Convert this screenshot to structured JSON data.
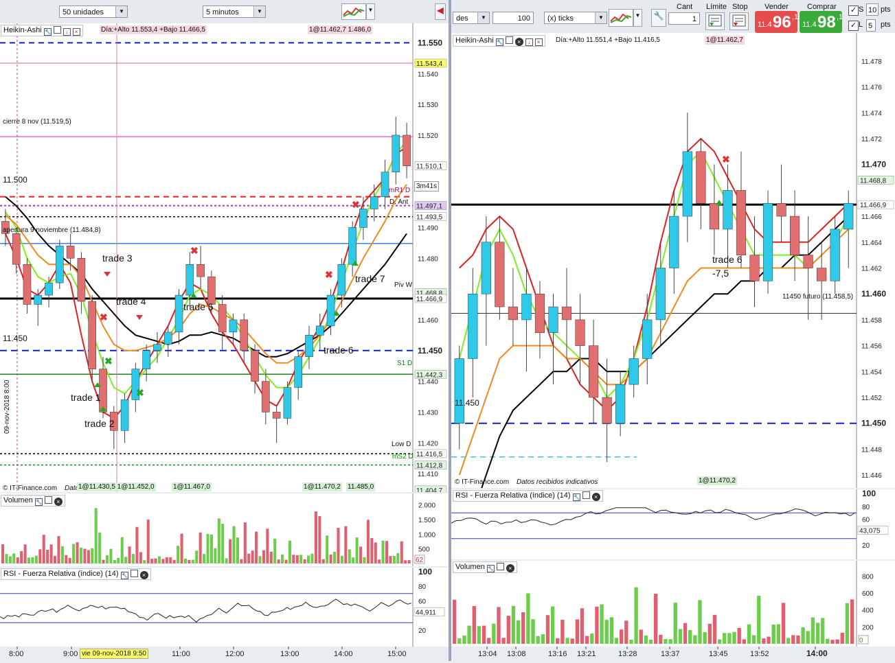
{
  "left_toolbar": {
    "quantity": "50 unidades",
    "timeframe": "5 minutos"
  },
  "right_toolbar": {
    "account_fragment": "des",
    "ticks_value": "100",
    "ticks_unit": "(x) ticks",
    "cant_label": "Cant",
    "cant_value": "1",
    "limite_label": "Límite",
    "stop_label": "Stop",
    "vender_label": "Vender",
    "vender_prefix": "11.4",
    "vender_big": "96",
    "vender_sup": ",1",
    "comprar_label": "Comprar",
    "comprar_prefix": "11.4",
    "comprar_big": "98",
    "comprar_sup": ",1",
    "s_label": "S",
    "s_value": "10",
    "s_unit": "pts",
    "l_label": "L",
    "l_value": "5",
    "l_unit": "pts"
  },
  "left_panel": {
    "title": "Heikin-Ashi",
    "overlay": "Día:+Alto 11.553,4 +Bajo 11.466,5",
    "top_tag": "1@11.462,7  1.486,0",
    "bottom_tags": [
      "1@11.430,5 1@11.452,0",
      "1@11.467,0",
      "1@11.470,2",
      "11.485,0"
    ],
    "timer": "3m41s",
    "lines": [
      "cierre 8 nov (11.519,5)",
      "11.500",
      "apertura 9 noviembre (11.484,8)",
      "11.450",
      "Piv W",
      "S1 D",
      "Low D",
      "mS2 D",
      "D, Ant",
      "mR1 D"
    ],
    "vertical_date": "09-nov-2018 8:00",
    "footer": "© IT-Finance.com",
    "footer2": "Datos recibidos indicativos"
  },
  "right_panel": {
    "title": "Heikin-Ashi",
    "overlay": "Día:+Alto 11.551,4 +Bajo 11.416,5",
    "top_tag": "1@11.462,7",
    "bottom_tag": "1@11.470,2",
    "futuro": "11450 futuro (11.458,5)",
    "line_label": "11.450",
    "footer": "© IT-Finance.com",
    "footer2": "Datos recibidos indicativos"
  },
  "left_volume": {
    "title": "Volumen",
    "axis": [
      "2.000",
      "1.500",
      "1.000",
      "500"
    ],
    "last": "62"
  },
  "left_rsi": {
    "title": "RSI - Fuerza Relativa (índice) (14)",
    "axis": [
      "100",
      "80",
      "60",
      "20"
    ],
    "last": "44,911"
  },
  "right_rsi": {
    "title": "RSI - Fuerza Relativa (índice) (14)",
    "axis": [
      "100",
      "80",
      "60",
      "20"
    ],
    "last": "43,075"
  },
  "right_volume": {
    "title": "Volumen",
    "axis": [
      "800",
      "600",
      "400",
      "200"
    ],
    "last": "0"
  },
  "left_xaxis": [
    "8:00",
    "9:00",
    "11:00",
    "12:00",
    "13:00",
    "14:00",
    "15:00"
  ],
  "left_cursor_date": "vie 09-nov-2018 9:50",
  "right_xaxis": [
    "13:04",
    "13:08",
    "13:16",
    "13:21",
    "13:28",
    "13:37",
    "13:45",
    "13:52",
    "14:00"
  ],
  "left_yaxis": [
    "11.550",
    "11.540",
    "11.530",
    "11.520",
    "11.490",
    "11.480",
    "11.460",
    "11.450",
    "11.440",
    "11.430",
    "11.420",
    "11.410"
  ],
  "left_ytags": [
    {
      "text": "11.543,4",
      "bg": "#ffff66"
    },
    {
      "text": "11.510,1",
      "bg": "#ffffff"
    },
    {
      "text": "11.497,1",
      "bg": "#e0c8f0"
    },
    {
      "text": "11.493,5",
      "bg": "#ffffff"
    },
    {
      "text": "11.468,8",
      "bg": "#e2f5e2"
    },
    {
      "text": "11.466,9",
      "bg": "#ffffff"
    },
    {
      "text": "11.442,3",
      "bg": "#e2f5e2"
    },
    {
      "text": "11.416,5",
      "bg": "#ffffff"
    },
    {
      "text": "11.412,8",
      "bg": "#e2f5e2"
    },
    {
      "text": "11.404,7",
      "bg": "#e2f5e2"
    }
  ],
  "right_yaxis": [
    "11.478",
    "11.476",
    "11.474",
    "11.472",
    "11.470",
    "11.466",
    "11.464",
    "11.462",
    "11.460",
    "11.458",
    "11.456",
    "11.454",
    "11.452",
    "11.450",
    "11.448",
    "11.446"
  ],
  "right_ytags": [
    {
      "text": "11.468,8",
      "bg": "#e2f5e2"
    },
    {
      "text": "11.466,9",
      "bg": "#ffffff"
    }
  ],
  "trades_left": [
    "trade 1",
    "trade 2",
    "trade 3",
    "trade 4",
    "trade 5",
    "trade 6",
    "trade 7"
  ],
  "trades_right": [
    "trade 6",
    "-7,5"
  ],
  "chart_data": [
    {
      "type": "candlestick",
      "name": "Heikin-Ashi 5 minutos",
      "x_range": [
        "08:00",
        "15:10"
      ],
      "ylim": [
        11404,
        11555
      ],
      "ohlc": [
        [
          11492,
          11496,
          11484,
          11488
        ],
        [
          11488,
          11490,
          11475,
          11478
        ],
        [
          11478,
          11480,
          11462,
          11465
        ],
        [
          11465,
          11470,
          11458,
          11468
        ],
        [
          11468,
          11474,
          11464,
          11472
        ],
        [
          11472,
          11486,
          11470,
          11484
        ],
        [
          11484,
          11488,
          11476,
          11480
        ],
        [
          11480,
          11482,
          11462,
          11466
        ],
        [
          11466,
          11468,
          11440,
          11444
        ],
        [
          11444,
          11448,
          11428,
          11430
        ],
        [
          11430,
          11432,
          11418,
          11424
        ],
        [
          11424,
          11436,
          11420,
          11434
        ],
        [
          11434,
          11446,
          11430,
          11444
        ],
        [
          11444,
          11452,
          11440,
          11450
        ],
        [
          11450,
          11456,
          11446,
          11452
        ],
        [
          11452,
          11458,
          11448,
          11456
        ],
        [
          11456,
          11470,
          11452,
          11468
        ],
        [
          11468,
          11482,
          11464,
          11478
        ],
        [
          11478,
          11484,
          11470,
          11474
        ],
        [
          11474,
          11476,
          11462,
          11465
        ],
        [
          11465,
          11468,
          11450,
          11456
        ],
        [
          11456,
          11462,
          11452,
          11460
        ],
        [
          11460,
          11462,
          11446,
          11450
        ],
        [
          11450,
          11452,
          11436,
          11440
        ],
        [
          11440,
          11444,
          11426,
          11430
        ],
        [
          11430,
          11432,
          11420,
          11428
        ],
        [
          11428,
          11440,
          11426,
          11438
        ],
        [
          11438,
          11450,
          11434,
          11448
        ],
        [
          11448,
          11458,
          11444,
          11455
        ],
        [
          11455,
          11462,
          11450,
          11458
        ],
        [
          11458,
          11470,
          11455,
          11468
        ],
        [
          11468,
          11480,
          11464,
          11478
        ],
        [
          11478,
          11492,
          11474,
          11490
        ],
        [
          11490,
          11500,
          11486,
          11496
        ],
        [
          11496,
          11504,
          11492,
          11500
        ],
        [
          11500,
          11512,
          11496,
          11508
        ],
        [
          11508,
          11526,
          11504,
          11520
        ],
        [
          11520,
          11524,
          11506,
          11510
        ]
      ],
      "series": [
        {
          "name": "MA",
          "color": "#000000",
          "values": [
            11500,
            11497,
            11493,
            11488,
            11484,
            11481,
            11478,
            11475,
            11470,
            11466,
            11462,
            11458,
            11455,
            11454,
            11453,
            11452,
            11453,
            11455,
            11455,
            11456,
            11455,
            11454,
            11452,
            11450,
            11448,
            11448,
            11449,
            11451,
            11453,
            11455,
            11458,
            11462,
            11466,
            11470,
            11474,
            11478,
            11483,
            11488
          ]
        },
        {
          "name": "MA",
          "color": "#e02020",
          "values": [
            11488,
            11480,
            11470,
            11468,
            11472,
            11478,
            11472,
            11455,
            11440,
            11430,
            11428,
            11432,
            11440,
            11446,
            11452,
            11458,
            11466,
            11472,
            11470,
            11462,
            11456,
            11452,
            11446,
            11440,
            11434,
            11432,
            11438,
            11446,
            11452,
            11458,
            11466,
            11476,
            11488,
            11498,
            11502,
            11506,
            11514,
            11516
          ]
        },
        {
          "name": "MA",
          "color": "#7cf020",
          "values": [
            11495,
            11490,
            11480,
            11474,
            11472,
            11474,
            11475,
            11468,
            11456,
            11446,
            11438,
            11436,
            11440,
            11444,
            11448,
            11454,
            11460,
            11468,
            11470,
            11468,
            11464,
            11460,
            11454,
            11448,
            11442,
            11438,
            11438,
            11442,
            11448,
            11454,
            11462,
            11472,
            11482,
            11492,
            11500,
            11506,
            11514,
            11518
          ]
        },
        {
          "name": "MA",
          "color": "#f08a20",
          "values": [
            11494,
            11491,
            11486,
            11481,
            11478,
            11478,
            11478,
            11474,
            11466,
            11458,
            11452,
            11450,
            11450,
            11451,
            11452,
            11454,
            11457,
            11462,
            11465,
            11464,
            11462,
            11460,
            11457,
            11453,
            11449,
            11446,
            11446,
            11448,
            11451,
            11455,
            11460,
            11466,
            11473,
            11480,
            11486,
            11492,
            11499,
            11504
          ]
        }
      ],
      "annotations": [
        "trade 1",
        "trade 2",
        "trade 3",
        "trade 4",
        "trade 5",
        "trade 6",
        "trade 7",
        "cierre 8 nov (11.519,5)",
        "apertura 9 noviembre (11.484,8)"
      ],
      "levels": [
        11519.5,
        11500,
        11493.5,
        11484.8,
        11466.9,
        11450,
        11442.3,
        11416.5,
        11412.8
      ]
    },
    {
      "type": "candlestick",
      "name": "Heikin-Ashi",
      "x_range": [
        "13:00",
        "14:03"
      ],
      "ylim": [
        11445,
        11479
      ],
      "ohlc": [
        [
          11450,
          11456,
          11448,
          11455
        ],
        [
          11455,
          11462,
          11452,
          11460
        ],
        [
          11460,
          11466,
          11456,
          11464
        ],
        [
          11464,
          11466,
          11458,
          11459
        ],
        [
          11459,
          11462,
          11456,
          11458
        ],
        [
          11458,
          11462,
          11454,
          11460
        ],
        [
          11460,
          11461,
          11455,
          11457
        ],
        [
          11457,
          11460,
          11453,
          11459
        ],
        [
          11459,
          11462,
          11455,
          11458
        ],
        [
          11458,
          11460,
          11453,
          11456
        ],
        [
          11456,
          11458,
          11450,
          11452
        ],
        [
          11452,
          11455,
          11447,
          11450
        ],
        [
          11450,
          11454,
          11449,
          11453
        ],
        [
          11453,
          11456,
          11452,
          11455
        ],
        [
          11455,
          11460,
          11453,
          11458
        ],
        [
          11458,
          11464,
          11456,
          11462
        ],
        [
          11462,
          11468,
          11460,
          11466
        ],
        [
          11466,
          11474,
          11464,
          11471
        ],
        [
          11471,
          11472,
          11465,
          11467
        ],
        [
          11467,
          11470,
          11463,
          11465
        ],
        [
          11465,
          11470,
          11462,
          11468
        ],
        [
          11468,
          11471,
          11462,
          11463
        ],
        [
          11463,
          11466,
          11459,
          11461
        ],
        [
          11461,
          11468,
          11460,
          11467
        ],
        [
          11467,
          11470,
          11464,
          11466
        ],
        [
          11466,
          11468,
          11461,
          11463
        ],
        [
          11463,
          11466,
          11458,
          11462
        ],
        [
          11462,
          11464,
          11458,
          11461
        ],
        [
          11461,
          11466,
          11460,
          11465
        ],
        [
          11465,
          11468,
          11462,
          11467
        ]
      ],
      "series": [
        {
          "name": "MA",
          "color": "#000000",
          "values": [
            11440,
            11443,
            11446,
            11449,
            11451,
            11452,
            11453,
            11454,
            11454,
            11455,
            11455,
            11454,
            11454,
            11454,
            11455,
            11456,
            11457,
            11458,
            11459,
            11460,
            11460,
            11461,
            11461,
            11462,
            11462,
            11463,
            11463,
            11464,
            11465,
            11466
          ]
        },
        {
          "name": "MA",
          "color": "#e02020",
          "values": [
            11462,
            11463,
            11465,
            11466,
            11465,
            11462,
            11459,
            11456,
            11455,
            11453,
            11452,
            11451,
            11452,
            11455,
            11459,
            11464,
            11468,
            11471,
            11472,
            11471,
            11469,
            11467,
            11465,
            11464,
            11464,
            11464,
            11464,
            11465,
            11466,
            11467
          ]
        },
        {
          "name": "MA",
          "color": "#7cf020",
          "values": [
            11455,
            11459,
            11463,
            11465,
            11463,
            11460,
            11458,
            11457,
            11456,
            11455,
            11454,
            11452,
            11453,
            11455,
            11458,
            11462,
            11466,
            11470,
            11471,
            11469,
            11467,
            11465,
            11463,
            11463,
            11463,
            11463,
            11462,
            11463,
            11464,
            11466
          ]
        },
        {
          "name": "MA",
          "color": "#f08a20",
          "values": [
            11446,
            11449,
            11452,
            11455,
            11456,
            11456,
            11456,
            11456,
            11455,
            11455,
            11454,
            11453,
            11453,
            11454,
            11455,
            11457,
            11459,
            11461,
            11462,
            11462,
            11462,
            11462,
            11462,
            11462,
            11462,
            11462,
            11462,
            11463,
            11464,
            11465
          ]
        }
      ],
      "annotations": [
        "trade 6",
        "-7,5",
        "11450 futuro (11.458,5)"
      ],
      "levels": [
        11466.9,
        11458.5,
        11450
      ]
    }
  ]
}
